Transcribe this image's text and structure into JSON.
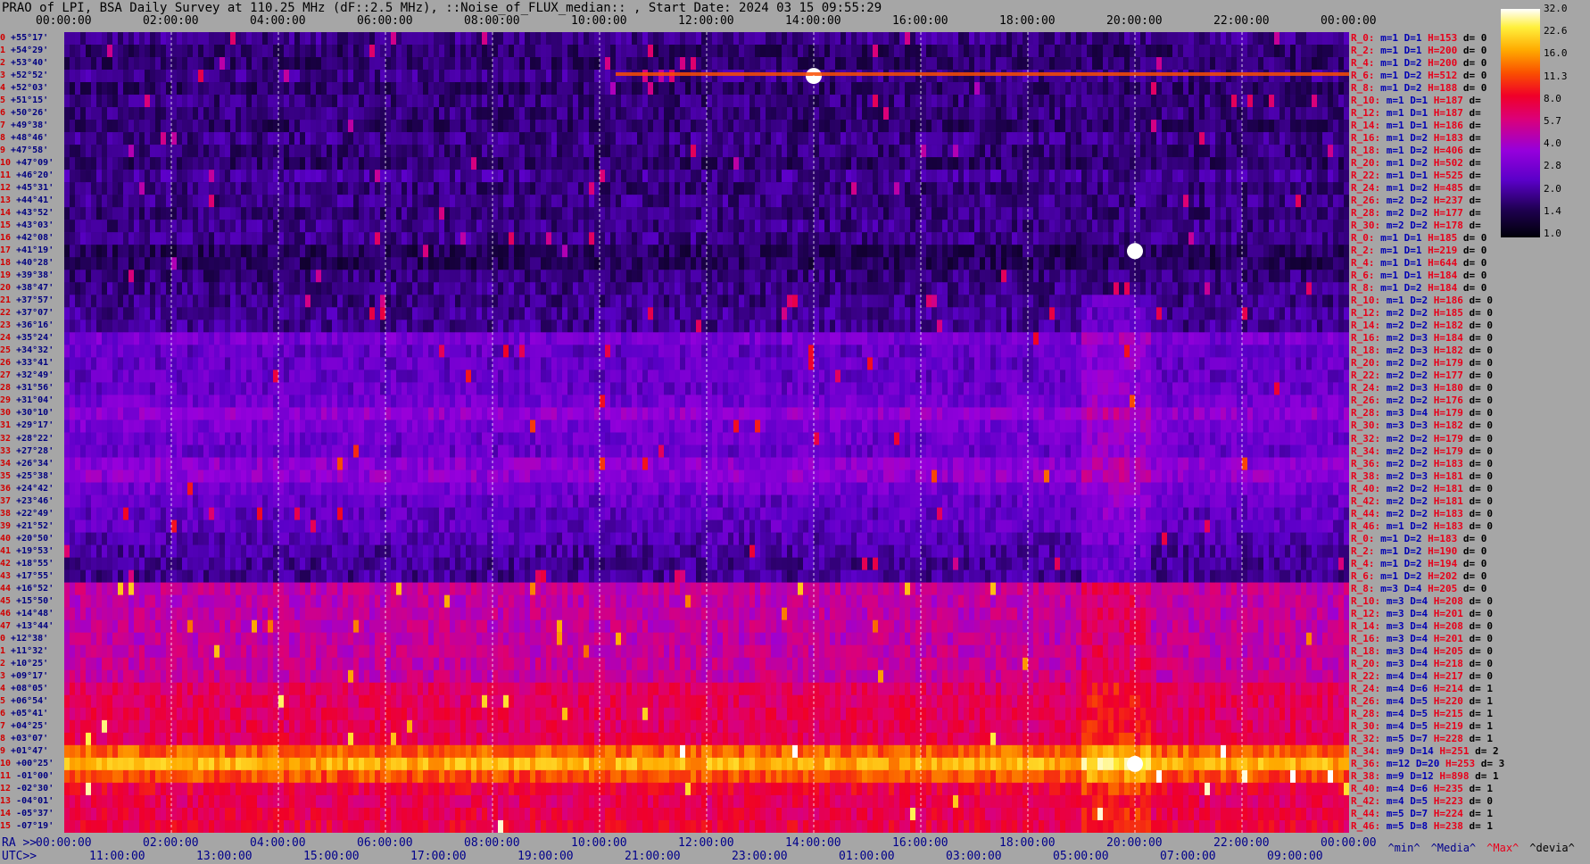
{
  "title": "PRAO of LPI, BSA Daily Survey at 110.25 MHz (dF::2.5 MHz), ::Noise_of_FLUX_median:: , Start Date: 2024 03 15 09:55:29",
  "top_axis_labels": [
    "00:00:00",
    "02:00:00",
    "04:00:00",
    "06:00:00",
    "08:00:00",
    "10:00:00",
    "12:00:00",
    "14:00:00",
    "16:00:00",
    "18:00:00",
    "20:00:00",
    "22:00:00",
    "00:00:00"
  ],
  "ra_axis": {
    "prefix": "RA >>",
    "labels": [
      "00:00:00",
      "02:00:00",
      "04:00:00",
      "06:00:00",
      "08:00:00",
      "10:00:00",
      "12:00:00",
      "14:00:00",
      "16:00:00",
      "18:00:00",
      "20:00:00",
      "22:00:00",
      "00:00:00"
    ]
  },
  "utc_axis": {
    "prefix": "UTC>>",
    "labels": [
      "11:00:00",
      "13:00:00",
      "15:00:00",
      "17:00:00",
      "19:00:00",
      "21:00:00",
      "23:00:00",
      "01:00:00",
      "03:00:00",
      "05:00:00",
      "07:00:00",
      "09:00:00"
    ]
  },
  "colorbar": {
    "labels": [
      "32.0",
      "22.6",
      "16.0",
      "11.3",
      "8.0",
      "5.7",
      "4.0",
      "2.8",
      "2.0",
      "1.4",
      "1.0"
    ]
  },
  "legend": {
    "min": "^min^",
    "median": "^Media^",
    "max": "^Max^",
    "devia": "^devia^"
  },
  "declinations": [
    "+55°17'",
    "+54°29'",
    "+53°40'",
    "+52°52'",
    "+52°03'",
    "+51°15'",
    "+50°26'",
    "+49°38'",
    "+48°46'",
    "+47°58'",
    "+47°09'",
    "+46°20'",
    "+45°31'",
    "+44°41'",
    "+43°52'",
    "+43°03'",
    "+42°08'",
    "+41°19'",
    "+40°28'",
    "+39°38'",
    "+38°47'",
    "+37°57'",
    "+37°07'",
    "+36°16'",
    "+35°24'",
    "+34°32'",
    "+33°41'",
    "+32°49'",
    "+31°56'",
    "+31°04'",
    "+30°10'",
    "+29°17'",
    "+28°22'",
    "+27°28'",
    "+26°34'",
    "+25°38'",
    "+24°42'",
    "+23°46'",
    "+22°49'",
    "+21°52'",
    "+20°50'",
    "+19°53'",
    "+18°55'",
    "+17°55'",
    "+16°52'",
    "+15°50'",
    "+14°48'",
    "+13°44'",
    "+12°38'",
    "+11°32'",
    "+10°25'",
    "+09°17'",
    "+08°05'",
    "+06°54'",
    "+05°41'",
    "+04°25'",
    "+03°07'",
    "+01°47'",
    "+00°25'",
    "-01°00'",
    "-02°30'",
    "-04°01'",
    "-05°37'",
    "-07°19'"
  ],
  "rows": [
    {
      "r": "R_0:",
      "m": "m=1",
      "d": "D=1",
      "h": "H=153",
      "dv": "d= 0"
    },
    {
      "r": "R_2:",
      "m": "m=1",
      "d": "D=1",
      "h": "H=200",
      "dv": "d= 0"
    },
    {
      "r": "R_4:",
      "m": "m=1",
      "d": "D=2",
      "h": "H=200",
      "dv": "d= 0"
    },
    {
      "r": "R_6:",
      "m": "m=1",
      "d": "D=2",
      "h": "H=512",
      "dv": "d= 0"
    },
    {
      "r": "R_8:",
      "m": "m=1",
      "d": "D=2",
      "h": "H=188",
      "dv": "d= 0"
    },
    {
      "r": "R_10:",
      "m": "m=1",
      "d": "D=1",
      "h": "H=187",
      "dv": "d="
    },
    {
      "r": "R_12:",
      "m": "m=1",
      "d": "D=1",
      "h": "H=187",
      "dv": "d="
    },
    {
      "r": "R_14:",
      "m": "m=1",
      "d": "D=1",
      "h": "H=186",
      "dv": "d="
    },
    {
      "r": "R_16:",
      "m": "m=1",
      "d": "D=2",
      "h": "H=183",
      "dv": "d="
    },
    {
      "r": "R_18:",
      "m": "m=1",
      "d": "D=2",
      "h": "H=406",
      "dv": "d="
    },
    {
      "r": "R_20:",
      "m": "m=1",
      "d": "D=2",
      "h": "H=502",
      "dv": "d="
    },
    {
      "r": "R_22:",
      "m": "m=1",
      "d": "D=1",
      "h": "H=525",
      "dv": "d="
    },
    {
      "r": "R_24:",
      "m": "m=1",
      "d": "D=2",
      "h": "H=485",
      "dv": "d="
    },
    {
      "r": "R_26:",
      "m": "m=2",
      "d": "D=2",
      "h": "H=237",
      "dv": "d="
    },
    {
      "r": "R_28:",
      "m": "m=2",
      "d": "D=2",
      "h": "H=177",
      "dv": "d="
    },
    {
      "r": "R_30:",
      "m": "m=2",
      "d": "D=2",
      "h": "H=178",
      "dv": "d="
    },
    {
      "r": "R_0:",
      "m": "m=1",
      "d": "D=1",
      "h": "H=185",
      "dv": "d= 0"
    },
    {
      "r": "R_2:",
      "m": "m=1",
      "d": "D=1",
      "h": "H=219",
      "dv": "d= 0"
    },
    {
      "r": "R_4:",
      "m": "m=1",
      "d": "D=1",
      "h": "H=644",
      "dv": "d= 0"
    },
    {
      "r": "R_6:",
      "m": "m=1",
      "d": "D=1",
      "h": "H=184",
      "dv": "d= 0"
    },
    {
      "r": "R_8:",
      "m": "m=1",
      "d": "D=2",
      "h": "H=184",
      "dv": "d= 0"
    },
    {
      "r": "R_10:",
      "m": "m=1",
      "d": "D=2",
      "h": "H=186",
      "dv": "d= 0"
    },
    {
      "r": "R_12:",
      "m": "m=2",
      "d": "D=2",
      "h": "H=185",
      "dv": "d= 0"
    },
    {
      "r": "R_14:",
      "m": "m=2",
      "d": "D=2",
      "h": "H=182",
      "dv": "d= 0"
    },
    {
      "r": "R_16:",
      "m": "m=2",
      "d": "D=3",
      "h": "H=184",
      "dv": "d= 0"
    },
    {
      "r": "R_18:",
      "m": "m=2",
      "d": "D=3",
      "h": "H=182",
      "dv": "d= 0"
    },
    {
      "r": "R_20:",
      "m": "m=2",
      "d": "D=2",
      "h": "H=179",
      "dv": "d= 0"
    },
    {
      "r": "R_22:",
      "m": "m=2",
      "d": "D=2",
      "h": "H=177",
      "dv": "d= 0"
    },
    {
      "r": "R_24:",
      "m": "m=2",
      "d": "D=3",
      "h": "H=180",
      "dv": "d= 0"
    },
    {
      "r": "R_26:",
      "m": "m=2",
      "d": "D=2",
      "h": "H=176",
      "dv": "d= 0"
    },
    {
      "r": "R_28:",
      "m": "m=3",
      "d": "D=4",
      "h": "H=179",
      "dv": "d= 0"
    },
    {
      "r": "R_30:",
      "m": "m=3",
      "d": "D=3",
      "h": "H=182",
      "dv": "d= 0"
    },
    {
      "r": "R_32:",
      "m": "m=2",
      "d": "D=2",
      "h": "H=179",
      "dv": "d= 0"
    },
    {
      "r": "R_34:",
      "m": "m=2",
      "d": "D=2",
      "h": "H=179",
      "dv": "d= 0"
    },
    {
      "r": "R_36:",
      "m": "m=2",
      "d": "D=2",
      "h": "H=183",
      "dv": "d= 0"
    },
    {
      "r": "R_38:",
      "m": "m=2",
      "d": "D=3",
      "h": "H=181",
      "dv": "d= 0"
    },
    {
      "r": "R_40:",
      "m": "m=2",
      "d": "D=2",
      "h": "H=181",
      "dv": "d= 0"
    },
    {
      "r": "R_42:",
      "m": "m=2",
      "d": "D=2",
      "h": "H=181",
      "dv": "d= 0"
    },
    {
      "r": "R_44:",
      "m": "m=2",
      "d": "D=2",
      "h": "H=183",
      "dv": "d= 0"
    },
    {
      "r": "R_46:",
      "m": "m=1",
      "d": "D=2",
      "h": "H=183",
      "dv": "d= 0"
    },
    {
      "r": "R_0:",
      "m": "m=1",
      "d": "D=2",
      "h": "H=183",
      "dv": "d= 0"
    },
    {
      "r": "R_2:",
      "m": "m=1",
      "d": "D=2",
      "h": "H=190",
      "dv": "d= 0"
    },
    {
      "r": "R_4:",
      "m": "m=1",
      "d": "D=2",
      "h": "H=194",
      "dv": "d= 0"
    },
    {
      "r": "R_6:",
      "m": "m=1",
      "d": "D=2",
      "h": "H=202",
      "dv": "d= 0"
    },
    {
      "r": "R_8:",
      "m": "m=3",
      "d": "D=4",
      "h": "H=205",
      "dv": "d= 0"
    },
    {
      "r": "R_10:",
      "m": "m=3",
      "d": "D=4",
      "h": "H=208",
      "dv": "d= 0"
    },
    {
      "r": "R_12:",
      "m": "m=3",
      "d": "D=4",
      "h": "H=201",
      "dv": "d= 0"
    },
    {
      "r": "R_14:",
      "m": "m=3",
      "d": "D=4",
      "h": "H=208",
      "dv": "d= 0"
    },
    {
      "r": "R_16:",
      "m": "m=3",
      "d": "D=4",
      "h": "H=201",
      "dv": "d= 0"
    },
    {
      "r": "R_18:",
      "m": "m=3",
      "d": "D=4",
      "h": "H=205",
      "dv": "d= 0"
    },
    {
      "r": "R_20:",
      "m": "m=3",
      "d": "D=4",
      "h": "H=218",
      "dv": "d= 0"
    },
    {
      "r": "R_22:",
      "m": "m=4",
      "d": "D=4",
      "h": "H=217",
      "dv": "d= 0"
    },
    {
      "r": "R_24:",
      "m": "m=4",
      "d": "D=6",
      "h": "H=214",
      "dv": "d= 1"
    },
    {
      "r": "R_26:",
      "m": "m=4",
      "d": "D=5",
      "h": "H=220",
      "dv": "d= 1"
    },
    {
      "r": "R_28:",
      "m": "m=4",
      "d": "D=5",
      "h": "H=215",
      "dv": "d= 1"
    },
    {
      "r": "R_30:",
      "m": "m=4",
      "d": "D=5",
      "h": "H=219",
      "dv": "d= 1"
    },
    {
      "r": "R_32:",
      "m": "m=5",
      "d": "D=7",
      "h": "H=228",
      "dv": "d= 1"
    },
    {
      "r": "R_34:",
      "m": "m=9",
      "d": "D=14",
      "h": "H=251",
      "dv": "d= 2"
    },
    {
      "r": "R_36:",
      "m": "m=12",
      "d": "D=20",
      "h": "H=253",
      "dv": "d= 3"
    },
    {
      "r": "R_38:",
      "m": "m=9",
      "d": "D=12",
      "h": "H=898",
      "dv": "d= 1"
    },
    {
      "r": "R_40:",
      "m": "m=4",
      "d": "D=6",
      "h": "H=235",
      "dv": "d= 1"
    },
    {
      "r": "R_42:",
      "m": "m=4",
      "d": "D=5",
      "h": "H=223",
      "dv": "d= 0"
    },
    {
      "r": "R_44:",
      "m": "m=5",
      "d": "D=7",
      "h": "H=224",
      "dv": "d= 1"
    },
    {
      "r": "R_46:",
      "m": "m=5",
      "d": "D=8",
      "h": "H=238",
      "dv": "d= 1"
    }
  ],
  "chart_data": {
    "type": "heatmap",
    "title": "PRAO of LPI, BSA Daily Survey at 110.25 MHz (dF::2.5 MHz), ::Noise_of_FLUX_median:: , Start Date: 2024 03 15 09:55:29",
    "xlabel": "RA / UTC",
    "ylabel": "",
    "x_range": [
      "00:00:00",
      "24:00:00"
    ],
    "rows": 64,
    "color_scale": {
      "type": "log",
      "range": [
        1.0,
        32.0
      ],
      "colormap": "black-blue-purple-red-orange-yellow-white"
    },
    "row_levels": [
      1.9,
      1.7,
      1.7,
      1.9,
      1.7,
      1.8,
      1.8,
      1.7,
      1.9,
      1.8,
      1.7,
      2.0,
      1.8,
      1.9,
      1.8,
      1.9,
      1.9,
      1.6,
      1.6,
      1.8,
      1.9,
      1.9,
      2.0,
      2.0,
      3.0,
      2.6,
      2.6,
      2.6,
      2.7,
      2.9,
      3.6,
      3.0,
      2.8,
      2.7,
      3.5,
      3.6,
      2.9,
      2.6,
      2.5,
      2.5,
      2.3,
      2.1,
      2.0,
      2.0,
      5.2,
      5.0,
      5.0,
      5.1,
      5.0,
      5.2,
      5.3,
      5.4,
      6.8,
      7.0,
      7.1,
      7.0,
      7.3,
      13.0,
      18.0,
      12.0,
      8.0,
      7.2,
      7.5,
      7.8
    ],
    "bright_events": [
      {
        "ra": "20:00:00",
        "row": 17,
        "value": 32.0
      },
      {
        "ra": "14:00:00",
        "row": 3,
        "value": 32.0
      },
      {
        "ra": "20:00:00",
        "row": 58,
        "value": 32.0
      }
    ]
  }
}
